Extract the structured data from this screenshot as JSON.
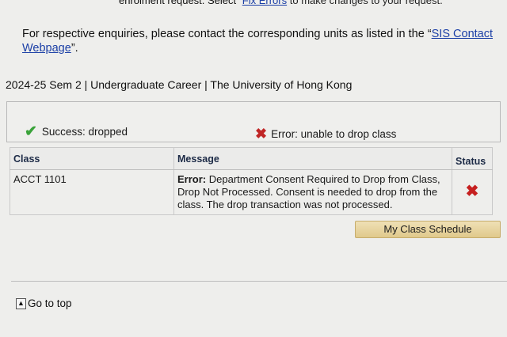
{
  "header_fragment": {
    "glyph": "'",
    "text_prefix": "enrolment request. Select",
    "link": "Fix Errors",
    "text_suffix": "to make changes to your request."
  },
  "enquiry": {
    "text": "For respective enquiries, please contact the corresponding units as listed in the “",
    "link": "SIS Contact Webpage",
    "suffix": "”."
  },
  "term_line": "2024-25 Sem 2 | Undergraduate Career | The University of Hong Kong",
  "summary": {
    "success_label": "Success: dropped",
    "error_label": "Error: unable to drop class"
  },
  "results_table": {
    "headers": {
      "class": "Class",
      "message": "Message",
      "status": "Status"
    },
    "rows": [
      {
        "class": "ACCT 1101",
        "message_prefix": "Error:",
        "message": " Department Consent Required to Drop from Class, Drop Not Processed. Consent is needed to drop from the class. The drop transaction was not processed.",
        "status_icon": "error-x-icon"
      }
    ]
  },
  "buttons": {
    "schedule": "My Class Schedule"
  },
  "footer": {
    "go_to_top": "Go to top"
  },
  "colors": {
    "success": "#3aa33a",
    "error": "#c02626",
    "link": "#1b3fa6",
    "button": "#e7d39c"
  }
}
